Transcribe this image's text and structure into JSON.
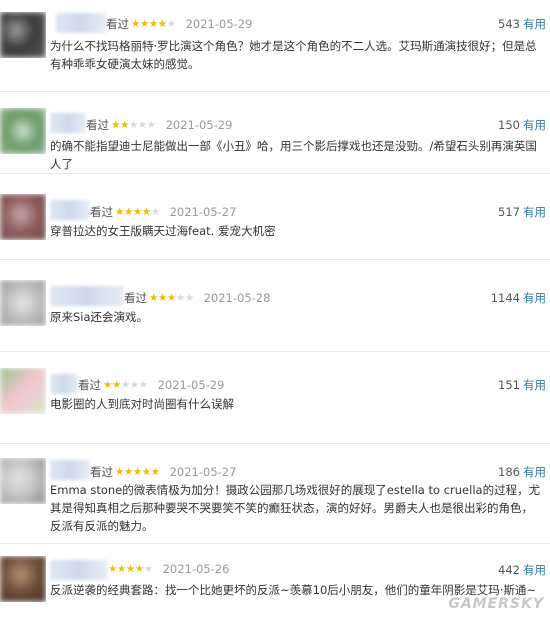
{
  "comments": [
    {
      "seen_label": "看过",
      "rating": 4,
      "date": "2021-05-29",
      "votes": "543",
      "useful_label": "有用",
      "text": "为什么不找玛格丽特·罗比演这个角色？她才是这个角色的不二人选。艾玛斯通演技很好；但是总有种乖乖女硬演太妹的感觉。",
      "avatar_colors": [
        "#3a3a3a",
        "#9a9a9a",
        "#5d5d5d"
      ]
    },
    {
      "seen_label": "看过",
      "rating": 2,
      "date": "2021-05-29",
      "votes": "150",
      "useful_label": "有用",
      "text": "的确不能指望迪士尼能做出一部《小丑》哈，用三个影后撑戏也还是没勁。/希望石头别再演英国人了",
      "avatar_colors": [
        "#6a9b6a",
        "#cfe0cf",
        "#8fb38f"
      ]
    },
    {
      "seen_label": "看过",
      "rating": 4,
      "date": "2021-05-27",
      "votes": "517",
      "useful_label": "有用",
      "text": "穿普拉达的女王版瞒天过海feat. 爱宠大机密",
      "avatar_colors": [
        "#8c5a5a",
        "#c9a8a8",
        "#6b4a4a"
      ]
    },
    {
      "seen_label": "看过",
      "rating": 3,
      "date": "2021-05-28",
      "votes": "1144",
      "useful_label": "有用",
      "text": "原来Sia还会演戏。",
      "avatar_colors": [
        "#bdbdbd",
        "#e8e8e8",
        "#9f9f9f"
      ]
    },
    {
      "seen_label": "看过",
      "rating": 2,
      "date": "2021-05-29",
      "votes": "151",
      "useful_label": "有用",
      "text": "电影圈的人到底对时尚圈有什么误解",
      "avatar_colors": [
        "#9dc48a",
        "#f3c6d0",
        "#d7e6c9"
      ]
    },
    {
      "seen_label": "看过",
      "rating": 5,
      "date": "2021-05-27",
      "votes": "186",
      "useful_label": "有用",
      "text": "Emma stone的微表情极为加分！摄政公园那几场戏很好的展现了estella to cruella的过程，尤其是得知真相之后那种要哭不哭要笑不笑的癫狂状态，演的好好。男爵夫人也是很出彩的角色，反派有反派的魅力。",
      "avatar_colors": [
        "#c9c9c9",
        "#8a8a8a",
        "#e3e3e3"
      ]
    },
    {
      "seen_label": "看过",
      "rating": 4,
      "date": "2021-05-26",
      "votes": "442",
      "useful_label": "有用",
      "text": "反派逆袭的经典套路：找一个比她更坏的反派~羡慕10后小朋友，他们的童年阴影是艾玛·斯通~",
      "avatar_colors": [
        "#6b4b3a",
        "#b8926f",
        "#4a3226"
      ]
    }
  ],
  "watermark": "GAMERSKY"
}
